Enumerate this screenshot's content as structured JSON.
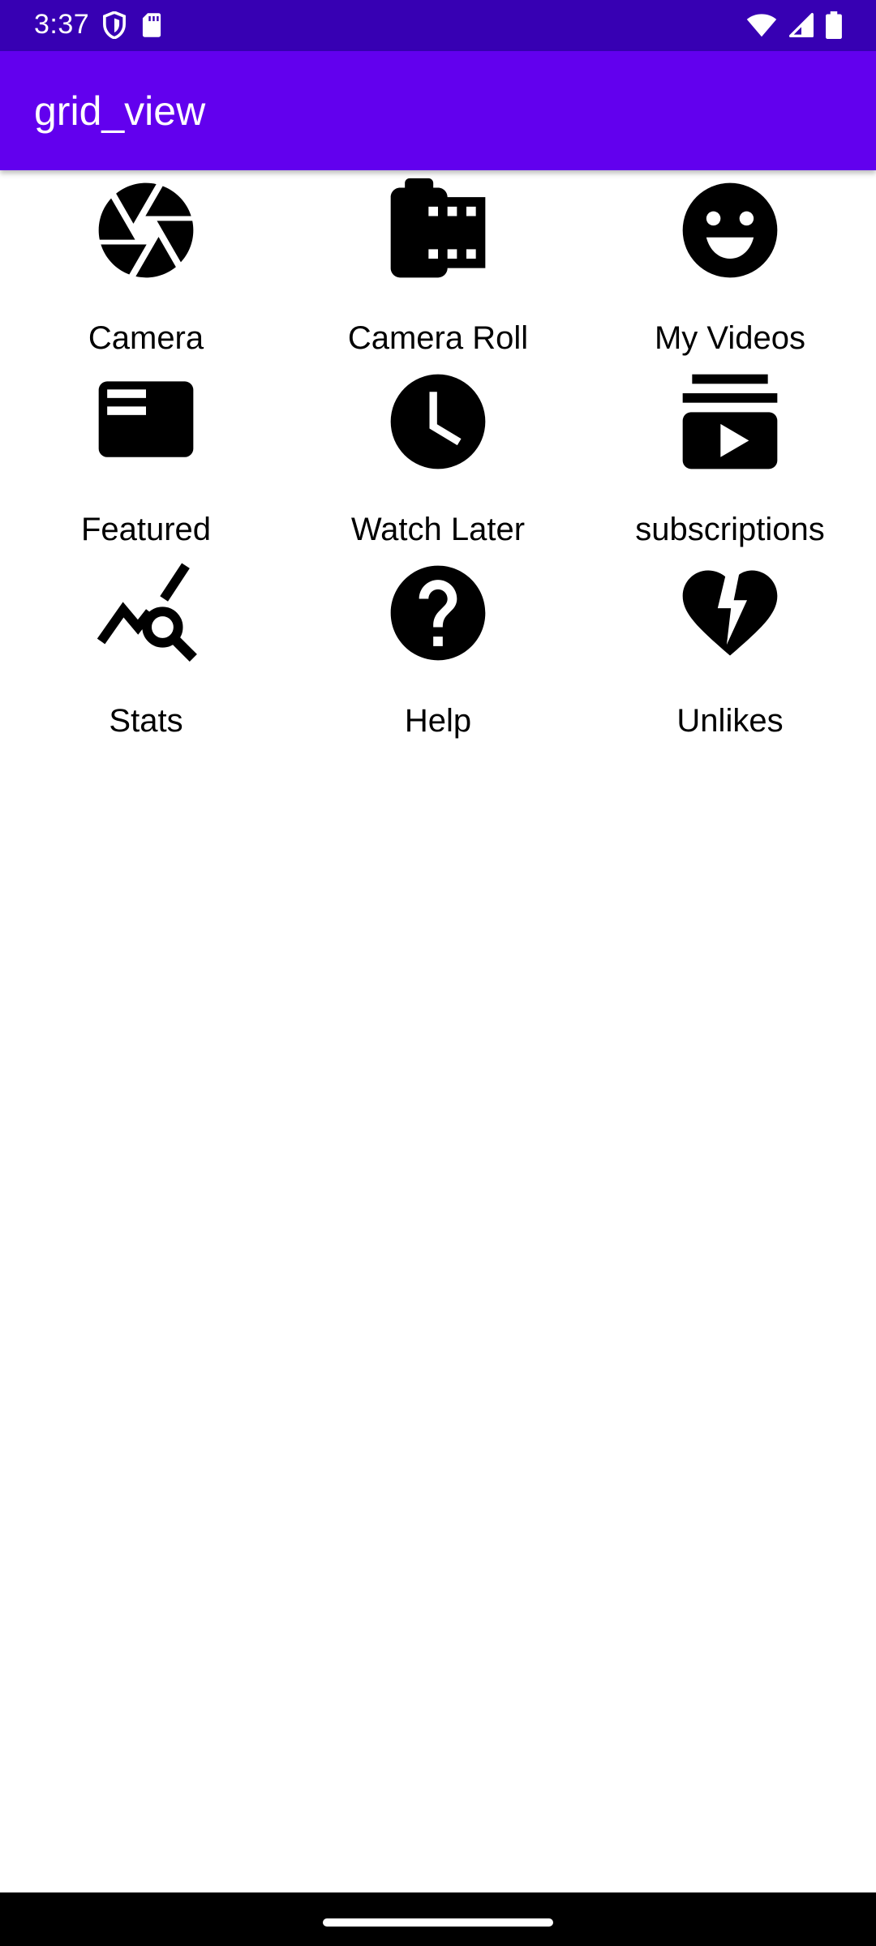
{
  "status_bar": {
    "time": "3:37",
    "left_icons": [
      "shield-icon",
      "sd-card-icon"
    ],
    "right_icons": [
      "wifi-icon",
      "cell-signal-icon",
      "battery-icon"
    ],
    "background_color": "#3700B3"
  },
  "app_bar": {
    "title": "grid_view",
    "background_color": "#6200EE"
  },
  "grid": {
    "items": [
      {
        "label": "Camera",
        "icon": "camera-aperture-icon"
      },
      {
        "label": "Camera Roll",
        "icon": "camera-roll-icon"
      },
      {
        "label": "My Videos",
        "icon": "smiley-face-icon"
      },
      {
        "label": "Featured",
        "icon": "featured-video-icon"
      },
      {
        "label": "Watch Later",
        "icon": "clock-icon"
      },
      {
        "label": "subscriptions",
        "icon": "subscriptions-icon"
      },
      {
        "label": "Stats",
        "icon": "stats-search-icon"
      },
      {
        "label": "Help",
        "icon": "help-icon"
      },
      {
        "label": "Unlikes",
        "icon": "broken-heart-icon"
      }
    ]
  }
}
